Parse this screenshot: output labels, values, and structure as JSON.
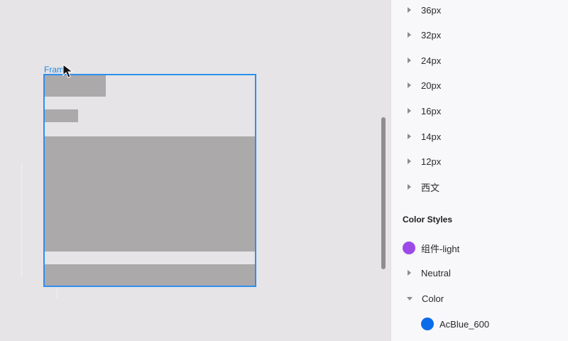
{
  "canvas": {
    "frame_label": "Fram"
  },
  "panel": {
    "text_styles": [
      "36px",
      "32px",
      "24px",
      "20px",
      "16px",
      "14px",
      "12px",
      "西文"
    ],
    "color_styles_title": "Color Styles",
    "color_styles": [
      {
        "name": "组件-light",
        "color": "#9b4ae8",
        "kind": "swatch"
      },
      {
        "name": "Neutral",
        "kind": "collapsed"
      },
      {
        "name": "Color",
        "kind": "expanded"
      },
      {
        "name": "AcBlue_600",
        "color": "#0a6ce8",
        "kind": "sub-swatch"
      }
    ]
  },
  "colors": {
    "accent": "#2c8ff0",
    "frame_fill": "#aca9ab",
    "canvas_bg": "#e6e4e6",
    "panel_bg": "#f8f7f9"
  }
}
